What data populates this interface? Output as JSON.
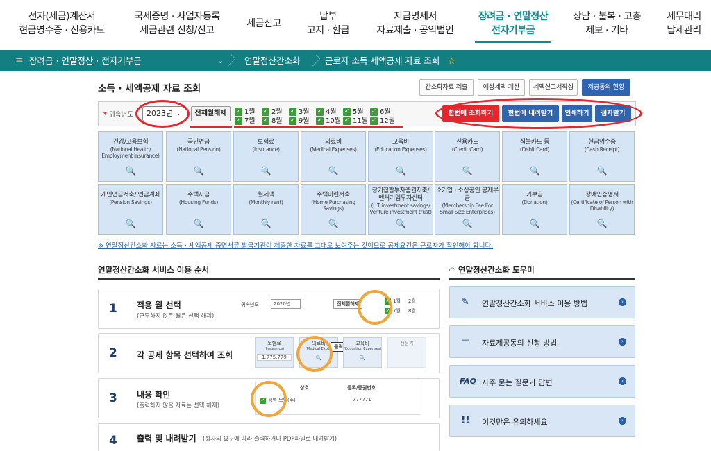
{
  "gnb": [
    {
      "line1": "전자(세금)계산서",
      "line2": "현금영수증 · 신용카드"
    },
    {
      "line1": "국세증명 · 사업자등록",
      "line2": "세금관련 신청/신고"
    },
    {
      "line1": "세금신고",
      "line2": ""
    },
    {
      "line1": "납부",
      "line2": "고지 · 환급"
    },
    {
      "line1": "지급명세서",
      "line2": "자료제출 · 공익법인"
    },
    {
      "line1": "장려금 · 연말정산",
      "line2": "전자기부금"
    },
    {
      "line1": "상담 · 불복 · 고충",
      "line2": "제보 · 기타"
    },
    {
      "line1": "세무대리",
      "line2": "납세관리"
    }
  ],
  "lnb": {
    "menu_icon": "≡",
    "section": "장려금 · 연말정산 · 전자기부금",
    "sub": "연말정산간소화",
    "current": "근로자 소득·세액공제 자료 조회",
    "star": "☆"
  },
  "page_title": "소득 · 세액공제 자료 조회",
  "top_buttons": [
    "간소화자료 제출",
    "예상세액 계산",
    "세액신고서작성",
    "제공동의 현황"
  ],
  "filter": {
    "required_mark": "*",
    "year_label": "귀속년도",
    "year_value": "2023년",
    "uncheck_all": "전체월해제",
    "months": [
      "1월",
      "2월",
      "3월",
      "4월",
      "5월",
      "6월",
      "7월",
      "8월",
      "9월",
      "10월",
      "11월",
      "12월"
    ],
    "check_mark": "✓"
  },
  "action_buttons": [
    "한번에 조회하기",
    "한번에 내려받기",
    "인쇄하기",
    "점자받기"
  ],
  "tiles": [
    {
      "kr": "건강/고용보험",
      "en": "(National Health/ Employment Insurance)"
    },
    {
      "kr": "국민연금",
      "en": "(National Pension)"
    },
    {
      "kr": "보험료",
      "en": "(Insurance)"
    },
    {
      "kr": "의료비",
      "en": "(Medical Expenses)"
    },
    {
      "kr": "교육비",
      "en": "(Education Expenses)"
    },
    {
      "kr": "신용카드",
      "en": "(Credit Card)"
    },
    {
      "kr": "직불카드 등",
      "en": "(Debit Card)"
    },
    {
      "kr": "현금영수증",
      "en": "(Cash Receipt)"
    },
    {
      "kr": "개인연금저축/ 연금계좌",
      "en": "(Pension Savings)"
    },
    {
      "kr": "주택자금",
      "en": "(Housing Funds)"
    },
    {
      "kr": "월세액",
      "en": "(Monthly rent)"
    },
    {
      "kr": "주택마련저축",
      "en": "(Home Purchasing Savings)"
    },
    {
      "kr": "장기집합투자증권저축/ 벤처기업투자신탁",
      "en": "(L.T investment savings/ Venture investment trust)"
    },
    {
      "kr": "소기업 · 소상공인 공제부금",
      "en": "(Membership Fee For Small Size Enterprises)"
    },
    {
      "kr": "기부금",
      "en": "(Donation)"
    },
    {
      "kr": "장애인증명서",
      "en": "(Certificate of Person with Disability)"
    }
  ],
  "search_glyph": "🔍",
  "notice": "※ 연말정산간소화 자료는 소득 · 세액공제 증명서류 발급기관이 제출한 자료를 그대로 보여주는 것이므로 공제요건은 근로자가 확인해야 합니다.",
  "steps_title": "연말정산간소화 서비스 이용 순서",
  "steps": [
    {
      "num": "1",
      "title": "적용 월 선택",
      "sub": "(근무하지 않은 월은 선택 해제)"
    },
    {
      "num": "2",
      "title": "각 공제 항목 선택하여 조회",
      "sub": ""
    },
    {
      "num": "3",
      "title": "내용 확인",
      "sub": "(출력하지 않을 자료는 선택 해제)"
    },
    {
      "num": "4",
      "title": "출력 및 내려받기",
      "sub": "(회사의 요구에 따라 출력하거나 PDF파일로 내려받기)"
    }
  ],
  "step_samples": {
    "s1_label": "귀속년도",
    "s1_year": "2020년",
    "s1_btn": "전체월해제",
    "s1_m1": "1월",
    "s1_m2": "2월",
    "s1_m7": "7월",
    "s1_m8": "8월",
    "s2_a": "보험료",
    "s2_a_en": "(Insurance)",
    "s2_a_val": "1,775,779",
    "s2_b": "의료비",
    "s2_b_en": "(Medical Expen",
    "s2_click": "클릭!",
    "s2_c": "교육비",
    "s2_c_en": "(Education Expenses)",
    "s2_d": "신용카",
    "s3_h1": "상호",
    "s3_h2": "등록/증권번호",
    "s3_v1": "생명",
    "s3_v2": "보험(주)",
    "s3_v3": "777771"
  },
  "help_title": "연말정산간소화 도우미",
  "help_items": [
    {
      "icon": "✎",
      "label": "연말정산간소화 서비스 이용 방법"
    },
    {
      "icon": "▭",
      "label": "자료제공동의 신청 방법"
    },
    {
      "icon": "FAQ",
      "label": "자주 묻는 질문과 답변"
    },
    {
      "icon": "!!",
      "label": "이것만은 유의하세요"
    }
  ],
  "help_arrow": "›",
  "colors": {
    "teal": "#137f83",
    "accent": "#0f8a8f",
    "red_btn": "#e5262c",
    "blue_btn": "#2f64b0",
    "annotation": "#e5262c"
  }
}
